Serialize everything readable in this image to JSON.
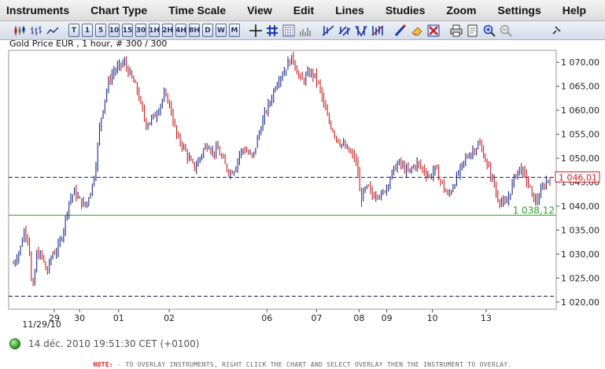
{
  "menu": [
    "Instruments",
    "Chart Type",
    "Time Scale",
    "View",
    "Edit",
    "Lines",
    "Studies",
    "Zoom",
    "Settings",
    "Help"
  ],
  "toolbar": {
    "chart_type_icons": [
      "candlestick-chart-icon",
      "bar-chart-icon",
      "line-chart-icon"
    ],
    "timescale_buttons": [
      "T",
      "1",
      "5",
      "10",
      "15",
      "30",
      "1H",
      "2H",
      "4H",
      "8H",
      "D",
      "W",
      "M"
    ],
    "tool_icons": [
      "crosshair-icon",
      "grid-icon",
      "data-window-icon",
      "volume-icon",
      "trendline-icon",
      "channel-icon",
      "fibonacci-icon",
      "retracement-icon",
      "pencil-icon",
      "eraser-icon",
      "delete-drawings-icon",
      "print-icon",
      "snapshot-icon",
      "zoom-in-icon",
      "zoom-out-icon",
      "pin-icon"
    ]
  },
  "chart_title": "Gold Price EUR , 1 hour, # 300 / 300",
  "chart_data": {
    "type": "ohlc",
    "ylim": [
      1018.5,
      1072.5
    ],
    "yticks": [
      1020,
      1025,
      1030,
      1035,
      1040,
      1045,
      1050,
      1055,
      1060,
      1065,
      1070
    ],
    "ytick_labels": [
      "1 020,00",
      "1 025,00",
      "1 030,00",
      "1 035,00",
      "1 040,00",
      "1 045,00",
      "1 050,00",
      "1 055,00",
      "1 060,00",
      "1 065,00",
      "1 070,00"
    ],
    "x_ticks": [
      {
        "label": "29",
        "pos": 0.0833
      },
      {
        "label": "30",
        "pos": 0.1295
      },
      {
        "label": "01",
        "pos": 0.2009
      },
      {
        "label": "02",
        "pos": 0.2932
      },
      {
        "label": "06",
        "pos": 0.4717
      },
      {
        "label": "07",
        "pos": 0.5625
      },
      {
        "label": "08",
        "pos": 0.6399
      },
      {
        "label": "09",
        "pos": 0.6905
      },
      {
        "label": "10",
        "pos": 0.7738
      },
      {
        "label": "13",
        "pos": 0.872
      }
    ],
    "x_sublabel": "11/29/10",
    "points": [
      [
        0,
        1028
      ],
      [
        6,
        1031
      ],
      [
        10,
        1035
      ],
      [
        14,
        1033
      ],
      [
        17,
        1021
      ],
      [
        21,
        1030
      ],
      [
        26,
        1029.5
      ],
      [
        30,
        1026
      ],
      [
        35,
        1030
      ],
      [
        40,
        1031
      ],
      [
        45,
        1035
      ],
      [
        50,
        1041
      ],
      [
        55,
        1043
      ],
      [
        60,
        1041
      ],
      [
        65,
        1040
      ],
      [
        68,
        1042
      ],
      [
        72,
        1045
      ],
      [
        75,
        1050
      ],
      [
        78,
        1057
      ],
      [
        82,
        1062
      ],
      [
        86,
        1066
      ],
      [
        90,
        1068
      ],
      [
        95,
        1069
      ],
      [
        100,
        1070
      ],
      [
        104,
        1068
      ],
      [
        108,
        1066
      ],
      [
        112,
        1064
      ],
      [
        116,
        1060
      ],
      [
        120,
        1057
      ],
      [
        124,
        1058
      ],
      [
        128,
        1059
      ],
      [
        132,
        1061
      ],
      [
        136,
        1063
      ],
      [
        140,
        1062
      ],
      [
        144,
        1058
      ],
      [
        148,
        1054
      ],
      [
        152,
        1053
      ],
      [
        156,
        1051
      ],
      [
        160,
        1049
      ],
      [
        164,
        1048
      ],
      [
        168,
        1050
      ],
      [
        172,
        1052
      ],
      [
        176,
        1053
      ],
      [
        180,
        1051
      ],
      [
        184,
        1052
      ],
      [
        188,
        1050
      ],
      [
        192,
        1048
      ],
      [
        196,
        1047
      ],
      [
        200,
        1048
      ],
      [
        204,
        1051
      ],
      [
        208,
        1052
      ],
      [
        212,
        1051
      ],
      [
        216,
        1050
      ],
      [
        220,
        1054
      ],
      [
        224,
        1057
      ],
      [
        228,
        1060
      ],
      [
        232,
        1062
      ],
      [
        236,
        1065
      ],
      [
        240,
        1067
      ],
      [
        244,
        1068
      ],
      [
        248,
        1070
      ],
      [
        252,
        1071
      ],
      [
        256,
        1068
      ],
      [
        260,
        1066
      ],
      [
        264,
        1067
      ],
      [
        268,
        1068
      ],
      [
        272,
        1067
      ],
      [
        276,
        1065
      ],
      [
        280,
        1061
      ],
      [
        284,
        1058
      ],
      [
        288,
        1056
      ],
      [
        292,
        1054
      ],
      [
        296,
        1053
      ],
      [
        300,
        1052
      ],
      [
        304,
        1051
      ],
      [
        308,
        1050
      ],
      [
        311,
        1047
      ],
      [
        313,
        1041
      ],
      [
        316,
        1043
      ],
      [
        320,
        1044
      ],
      [
        324,
        1042
      ],
      [
        328,
        1043
      ],
      [
        332,
        1042
      ],
      [
        336,
        1044
      ],
      [
        340,
        1046
      ],
      [
        344,
        1048
      ],
      [
        348,
        1049
      ],
      [
        352,
        1048
      ],
      [
        356,
        1047
      ],
      [
        360,
        1048
      ],
      [
        364,
        1049
      ],
      [
        368,
        1048
      ],
      [
        372,
        1047
      ],
      [
        376,
        1046
      ],
      [
        380,
        1048
      ],
      [
        384,
        1046
      ],
      [
        388,
        1044
      ],
      [
        392,
        1042
      ],
      [
        396,
        1044
      ],
      [
        400,
        1046
      ],
      [
        404,
        1048
      ],
      [
        408,
        1050
      ],
      [
        412,
        1051
      ],
      [
        416,
        1052
      ],
      [
        420,
        1053
      ],
      [
        424,
        1051
      ],
      [
        428,
        1048
      ],
      [
        432,
        1046
      ],
      [
        436,
        1042
      ],
      [
        440,
        1041
      ],
      [
        444,
        1040
      ],
      [
        448,
        1043
      ],
      [
        452,
        1046
      ],
      [
        456,
        1048
      ],
      [
        460,
        1047
      ],
      [
        464,
        1045
      ],
      [
        468,
        1042
      ],
      [
        472,
        1041
      ],
      [
        476,
        1043
      ],
      [
        480,
        1045
      ],
      [
        484,
        1046
      ]
    ],
    "hlines": [
      {
        "value": 1046.01,
        "style": "dashed",
        "color": "#1a1a5a",
        "label": "1 046,01",
        "label_color": "#c81e1e",
        "label_boxed": true
      },
      {
        "value": 1038.12,
        "style": "solid",
        "color": "#2aa52a",
        "label": "1 038,12",
        "label_color": "#2aa52a",
        "label_boxed": false
      },
      {
        "value": 1021.2,
        "style": "dashed",
        "color": "#1a1a5a",
        "label": "",
        "label_color": "#1a1a5a",
        "label_boxed": false
      }
    ],
    "up_color": "#1a2a8a",
    "down_color": "#c81e1e",
    "grid": false
  },
  "status": {
    "time": "14 déc. 2010 19:51:30  CET (+0100)"
  },
  "note": {
    "label": "NOTE:",
    "text": " - TO OVERLAY INSTRUMENTS, RIGHT CLICK THE CHART AND SELECT OVERLAY THEN THE INSTRUMENT TO OVERLAY."
  }
}
